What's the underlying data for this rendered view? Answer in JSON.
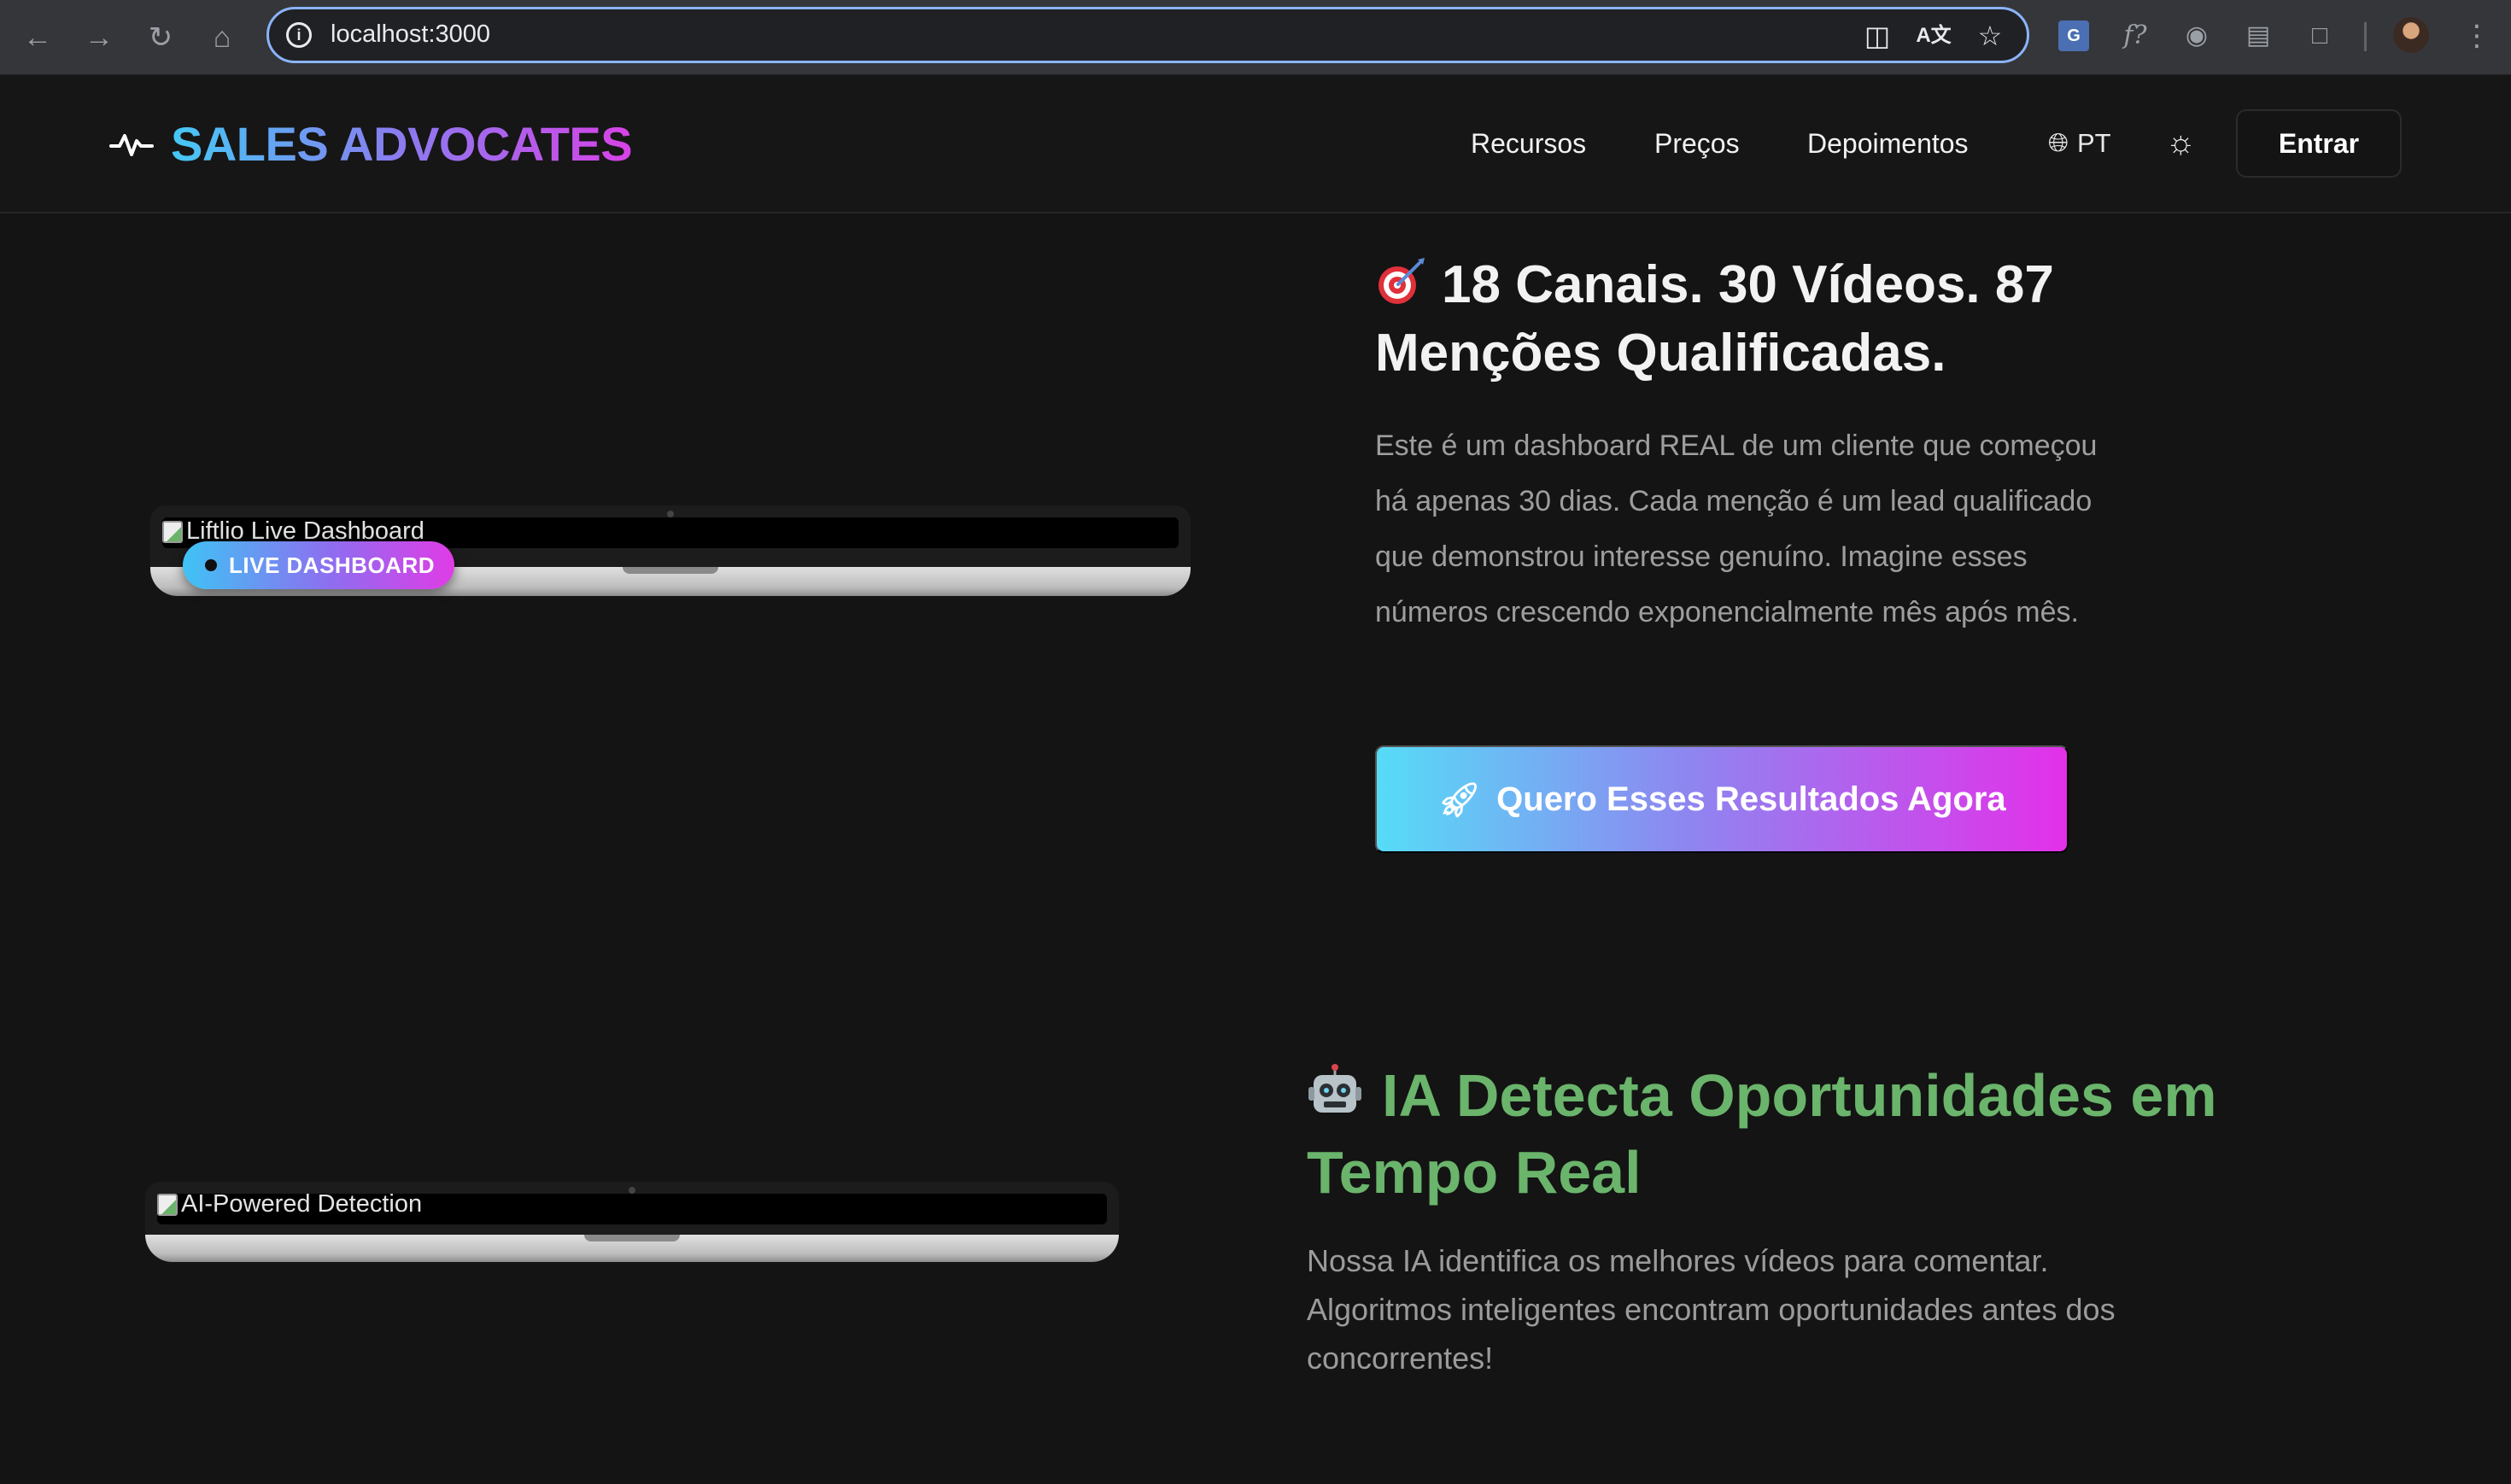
{
  "browser": {
    "url": "localhost:3000",
    "nav_icons": [
      "back-arrow-icon",
      "forward-arrow-icon",
      "reload-icon",
      "home-icon"
    ],
    "extensions": [
      "google-translate-icon",
      "function-icon",
      "camera-icon",
      "stack-icon",
      "puzzle-icon"
    ]
  },
  "header": {
    "brand": "SALES ADVOCATES",
    "nav": [
      "Recursos",
      "Preços",
      "Depoimentos"
    ],
    "language": "PT",
    "login_label": "Entrar"
  },
  "section1": {
    "image_alt": "Liftlio Live Dashboard",
    "badge": "LIVE DASHBOARD",
    "heading": "18 Canais. 30 Vídeos. 87 Menções Qualificadas.",
    "paragraph": "Este é um dashboard REAL de um cliente que começou há apenas 30 dias. Cada menção é um lead qualificado que demonstrou interesse genuíno. Imagine esses números crescendo exponencialmente mês após mês.",
    "cta_label": "Quero Esses Resultados Agora"
  },
  "section2": {
    "image_alt": "AI-Powered Detection",
    "heading": "IA Detecta Oportunidades em Tempo Real",
    "paragraph": "Nossa IA identifica os melhores vídeos para comentar. Algoritmos inteligentes encontram oportunidades antes dos concorrentes!"
  },
  "colors": {
    "page_bg": "#141414",
    "brand_gradient": [
      "#45c8f5",
      "#8b7bf0",
      "#d742e6"
    ],
    "heading_green": "#6ab46b",
    "body_text": "#9e9e9e"
  }
}
